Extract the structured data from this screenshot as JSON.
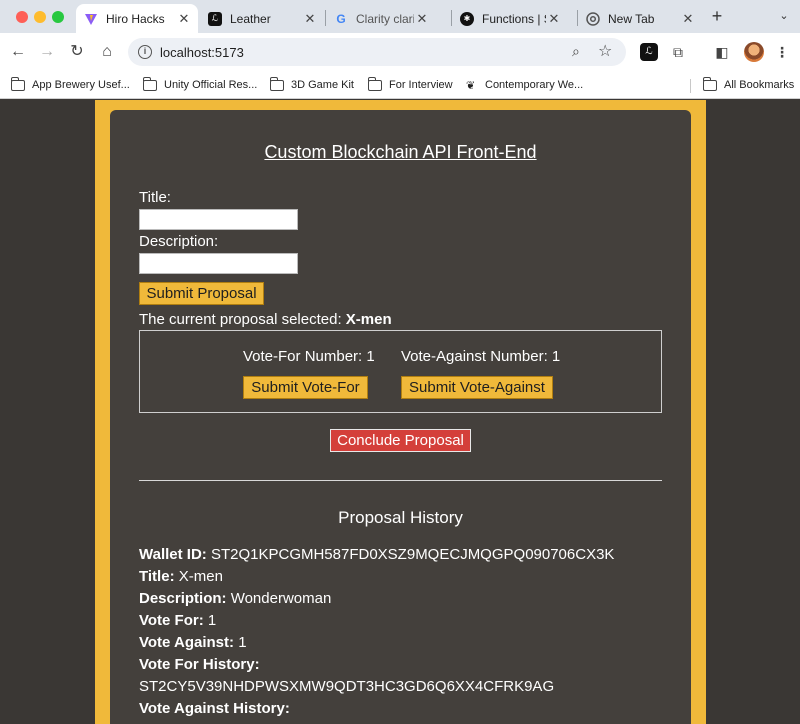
{
  "browser": {
    "tabs": [
      {
        "title": "Hiro Hacks",
        "active": true
      },
      {
        "title": "Leather",
        "active": false
      },
      {
        "title": "Clarity clarinet",
        "active": false
      },
      {
        "title": "Functions | Stacks",
        "active": false
      },
      {
        "title": "New Tab",
        "active": false
      }
    ],
    "url": "localhost:5173",
    "bookmarks": [
      {
        "label": "App Brewery Usef..."
      },
      {
        "label": "Unity Official Res..."
      },
      {
        "label": "3D Game Kit"
      },
      {
        "label": "For Interview"
      },
      {
        "label": "Contemporary We..."
      }
    ],
    "all_bookmarks": "All Bookmarks"
  },
  "app": {
    "heading": "Custom Blockchain API Front-End",
    "title_label": "Title:",
    "title_value": "",
    "description_label": "Description:",
    "description_value": "",
    "submit_proposal": "Submit Proposal",
    "current_prefix": "The current proposal selected:",
    "current_name": "X-men",
    "vote_for_count_label": "Vote-For Number: 1",
    "vote_against_count_label": "Vote-Against Number: 1",
    "submit_vote_for": "Submit Vote-For",
    "submit_vote_against": "Submit Vote-Against",
    "conclude": "Conclude Proposal",
    "history_title": "Proposal History",
    "history": {
      "wallet_label": "Wallet ID:",
      "wallet_value": "ST2Q1KPCGMH587FD0XSZ9MQECJMQGPQ090706CX3K",
      "title_label": "Title:",
      "title_value": "X-men",
      "description_label": "Description:",
      "description_value": "Wonderwoman",
      "vote_for_label": "Vote For:",
      "vote_for_value": "1",
      "vote_against_label": "Vote Against:",
      "vote_against_value": "1",
      "vote_for_history_label": "Vote For History:",
      "vote_for_history_value": "ST2CY5V39NHDPWSXMW9QDT3HC3GD6Q6XX4CFRK9AG",
      "vote_against_history_label": "Vote Against History:"
    }
  },
  "colors": {
    "accent_yellow": "#f0b93a",
    "card_bg": "#44403c",
    "danger_red": "#d43f3a"
  }
}
